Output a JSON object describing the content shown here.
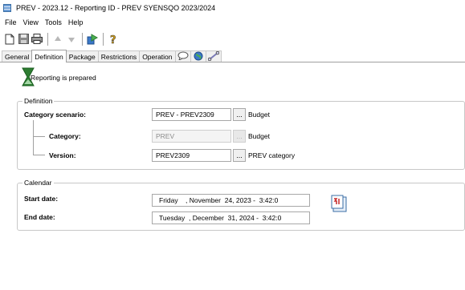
{
  "window": {
    "title": "PREV - 2023.12 - Reporting ID - PREV SYENSQO 2023/2024"
  },
  "menu": [
    "File",
    "View",
    "Tools",
    "Help"
  ],
  "toolbar": {
    "icons": [
      "new-document-icon",
      "save-icon",
      "print-icon",
      "arrow-up-icon",
      "arrow-down-icon",
      "run-icon",
      "help-icon"
    ]
  },
  "tabs": [
    {
      "label": "General"
    },
    {
      "label": "Definition",
      "active": true
    },
    {
      "label": "Package"
    },
    {
      "label": "Restrictions"
    },
    {
      "label": "Operation"
    }
  ],
  "status": {
    "text": "Reporting is prepared"
  },
  "definition": {
    "group_label": "Definition",
    "scenario": {
      "label": "Category scenario:",
      "value": "PREV - PREV2309",
      "button": "...",
      "desc": "Budget"
    },
    "category": {
      "label": "Category:",
      "value": "PREV",
      "button": "...",
      "desc": "Budget"
    },
    "version": {
      "label": "Version:",
      "value": "PREV2309",
      "button": "...",
      "desc": "PREV category"
    }
  },
  "calendar": {
    "group_label": "Calendar",
    "start": {
      "label": "Start date:",
      "value": "Friday    , November  24, 2023 -  3:42:0"
    },
    "end": {
      "label": "End date:",
      "value": "Tuesday  , December  31, 2024 -  3:42:0"
    }
  },
  "colors": {
    "accent": "#3a6ea5",
    "border": "#a8a8a8",
    "hourglass": "#2e7d32"
  }
}
